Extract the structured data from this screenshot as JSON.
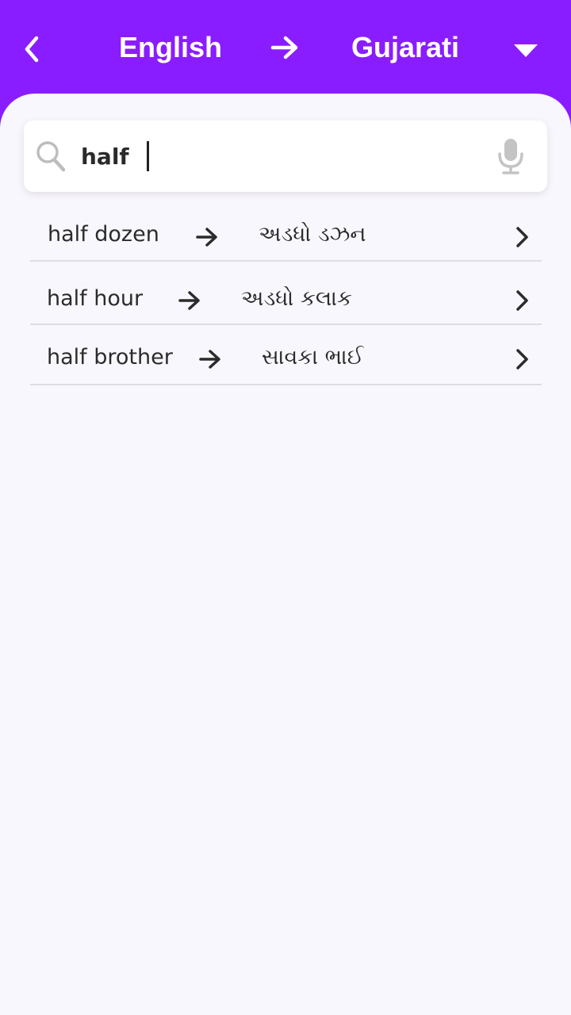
{
  "header": {
    "from_language": "English",
    "to_language": "Gujarati",
    "back_icon": "chevron-left-icon",
    "swap_icon": "arrow-right-icon",
    "dropdown_icon": "caret-down-icon",
    "background_color": "#8a1dff"
  },
  "search": {
    "value": "half",
    "search_icon": "search-icon",
    "mic_icon": "microphone-icon"
  },
  "results": [
    {
      "english": "half dozen",
      "gujarati": "અડધો ડઝન"
    },
    {
      "english": "half hour",
      "gujarati": "અડધો કલાક"
    },
    {
      "english": "half brother",
      "gujarati": "સાવકા ભાઈ"
    }
  ],
  "colors": {
    "accent": "#8a1dff",
    "content_background": "#f9f7fe",
    "text": "#2b2b2b",
    "divider": "#dedde2"
  }
}
